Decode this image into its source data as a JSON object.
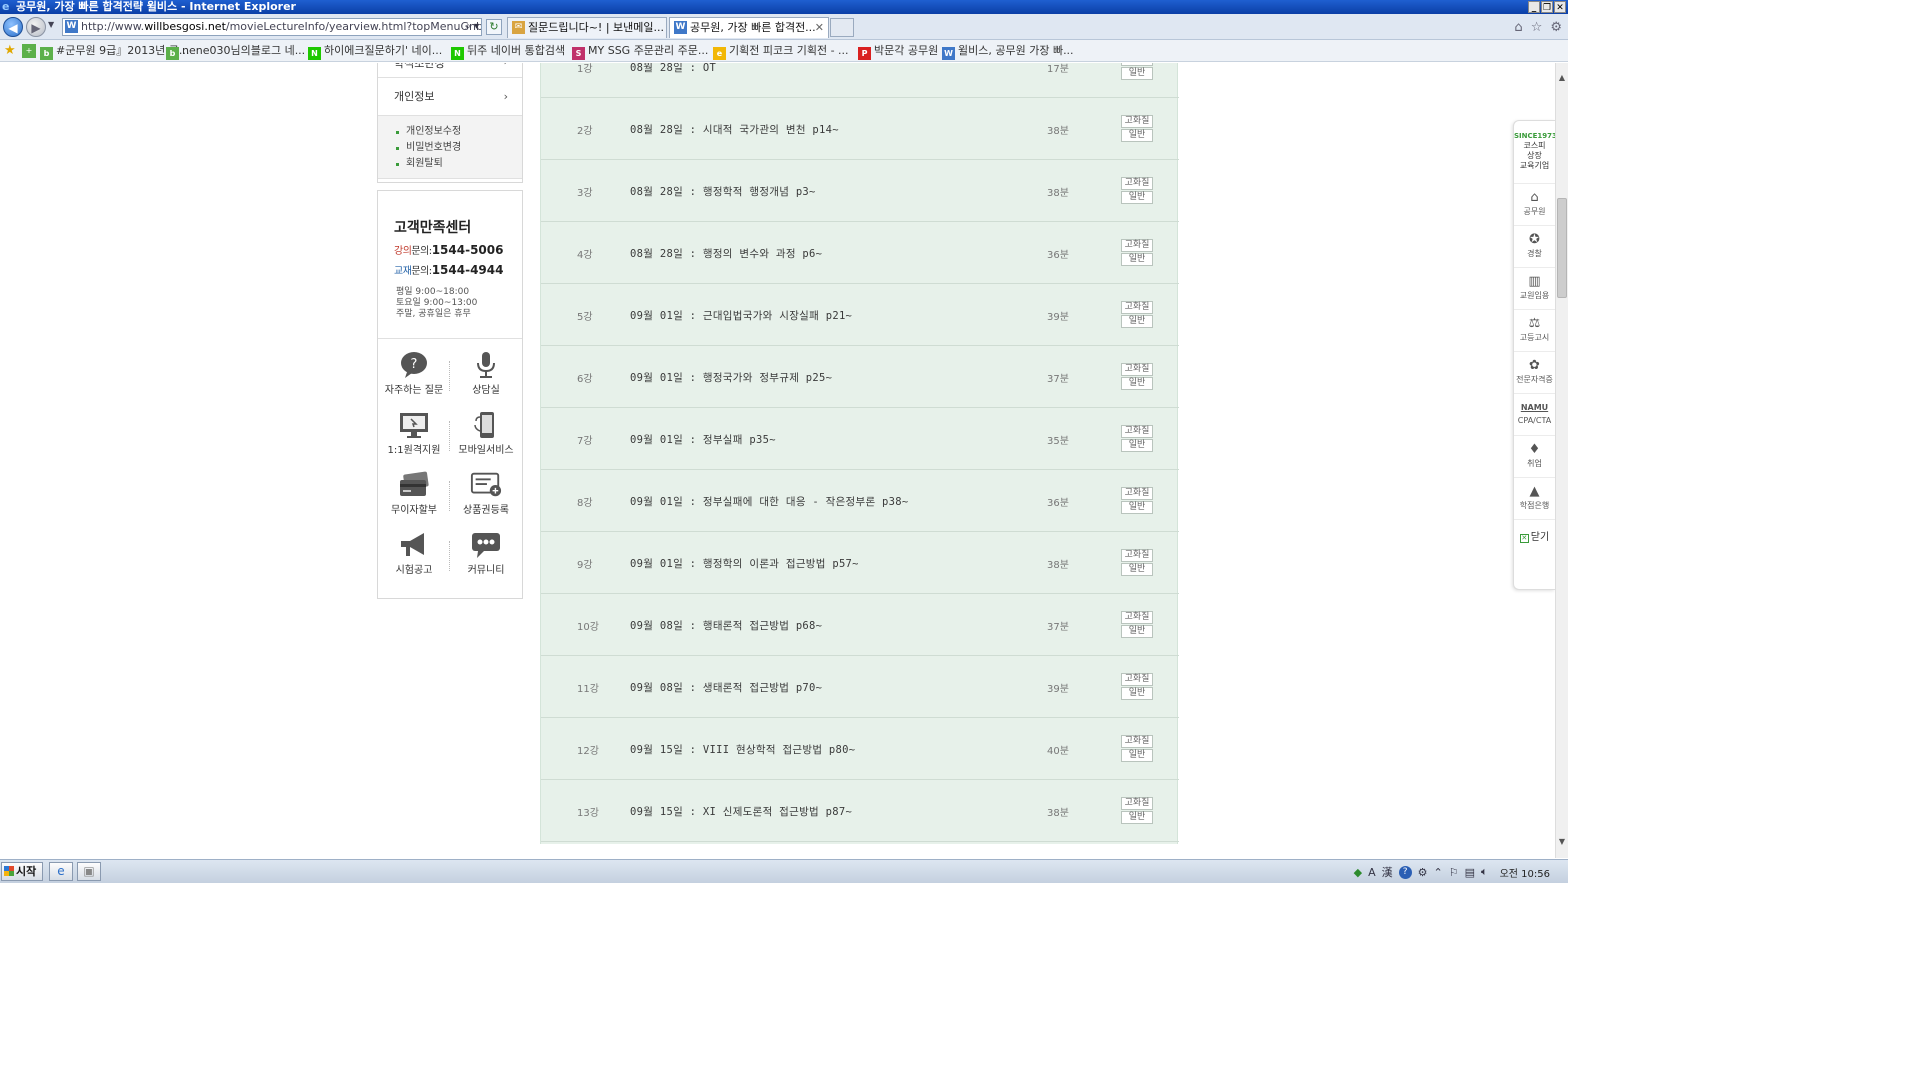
{
  "window": {
    "title": "공무원, 가장 빠른 합격전략 윌비스 - Internet Explorer"
  },
  "browser": {
    "url_prefix": "http://www.",
    "url_host": "willbesgosi.net",
    "url_rest": "/movieLectureInfo/yearview.html?topMenuGnb=OM...",
    "tabs": [
      {
        "label": "질문드립니다~! | 보낸메일...",
        "active": false
      },
      {
        "label": "공무원, 가장 빠른 합격전...",
        "active": true
      }
    ]
  },
  "favorites": [
    {
      "label": "#군무원 9급』2013년 군...",
      "icon": "blog-icon",
      "color": "#5cb04a"
    },
    {
      "label": "nene030님의블로그 네...",
      "icon": "blog-icon",
      "color": "#5cb04a"
    },
    {
      "label": "하이에크질문하기' 네이...",
      "icon": "naver-icon",
      "color": "#1ec800"
    },
    {
      "label": "뒤주 네이버 통합검색",
      "icon": "naver-icon",
      "color": "#1ec800"
    },
    {
      "label": "MY SSG 주문관리 주문...",
      "icon": "ssg-icon",
      "color": "#c0306a"
    },
    {
      "label": "기획전 피코크 기획전 - ...",
      "icon": "emart-icon",
      "color": "#f2b705"
    },
    {
      "label": "박문각 공무원",
      "icon": "pmg-icon",
      "color": "#d92020"
    },
    {
      "label": "윌비스, 공무원 가장 빠...",
      "icon": "willbes-icon",
      "color": "#3f78c8"
    }
  ],
  "sidebar": {
    "cut_label": "학석조반성",
    "menu_header": "개인정보",
    "submenu": [
      "개인정보수정",
      "비밀번호변경",
      "회원탈퇴"
    ],
    "cs": {
      "title": "고객만족센터",
      "lecture_hl": "강의",
      "lecture_rest": "문의:",
      "lecture_phone": "1544-5006",
      "book_hl": "교재",
      "book_rest": "문의:",
      "book_phone": "1544-4944",
      "hours": [
        "평일 9:00~18:00",
        "토요일 9:00~13:00",
        "주말, 공휴일은 휴무"
      ]
    },
    "services": [
      {
        "label": "자주하는 질문",
        "icon": "faq-icon"
      },
      {
        "label": "상담실",
        "icon": "microphone-icon"
      },
      {
        "label": "1:1원격지원",
        "icon": "monitor-icon"
      },
      {
        "label": "모바일서비스",
        "icon": "mobile-icon"
      },
      {
        "label": "무이자할부",
        "icon": "card-icon"
      },
      {
        "label": "상품권등록",
        "icon": "coupon-icon"
      },
      {
        "label": "시험공고",
        "icon": "megaphone-icon"
      },
      {
        "label": "커뮤니티",
        "icon": "chat-icon"
      }
    ]
  },
  "lectures": {
    "hq_label": "고화질",
    "normal_label": "일반",
    "rows": [
      {
        "no": "1강",
        "title": "08월 28일 : OT",
        "duration": "17분"
      },
      {
        "no": "2강",
        "title": "08월 28일 : 시대적 국가관의 변천 p14~",
        "duration": "38분"
      },
      {
        "no": "3강",
        "title": "08월 28일 : 행정학적 행정개념 p3~",
        "duration": "38분"
      },
      {
        "no": "4강",
        "title": "08월 28일 : 행정의 변수와 과정 p6~",
        "duration": "36분"
      },
      {
        "no": "5강",
        "title": "09월 01일 : 근대입법국가와 시장실패 p21~",
        "duration": "39분"
      },
      {
        "no": "6강",
        "title": "09월 01일 : 행정국가와 정부규제 p25~",
        "duration": "37분"
      },
      {
        "no": "7강",
        "title": "09월 01일 : 정부실패 p35~",
        "duration": "35분"
      },
      {
        "no": "8강",
        "title": "09월 01일 : 정부실패에 대한 대응 - 작은정부론 p38~",
        "duration": "36분"
      },
      {
        "no": "9강",
        "title": "09월 01일 : 행정학의 이론과 접근방법 p57~",
        "duration": "38분"
      },
      {
        "no": "10강",
        "title": "09월 08일 : 행태론적 접근방법 p68~",
        "duration": "37분"
      },
      {
        "no": "11강",
        "title": "09월 08일 : 생태론적 접근방법 p70~",
        "duration": "39분"
      },
      {
        "no": "12강",
        "title": "09월 15일 : VIII 현상학적 접근방법 p80~",
        "duration": "40분"
      },
      {
        "no": "13강",
        "title": "09월 15일 : XI 신제도론적 접근방법 p87~",
        "duration": "38분"
      }
    ]
  },
  "quickbar": {
    "since": "SINCE1973",
    "since_sub": [
      "코스피",
      "상장",
      "교육기업"
    ],
    "items": [
      {
        "label": "공무원",
        "icon": "house-icon"
      },
      {
        "label": "경찰",
        "icon": "police-icon"
      },
      {
        "label": "교원임용",
        "icon": "school-icon"
      },
      {
        "label": "고등고시",
        "icon": "gavel-icon"
      },
      {
        "label": "전문자격증",
        "icon": "medal-icon"
      },
      {
        "label": "CPA/CTA",
        "icon": "namu-icon",
        "brand": "NAMU"
      },
      {
        "label": "취업",
        "icon": "tie-icon"
      },
      {
        "label": "학점은행",
        "icon": "graduation-icon"
      }
    ],
    "close_label": "닫기"
  },
  "taskbar": {
    "start_label": "시작",
    "ime": [
      "A",
      "漢"
    ],
    "clock": "오전 10:56"
  }
}
